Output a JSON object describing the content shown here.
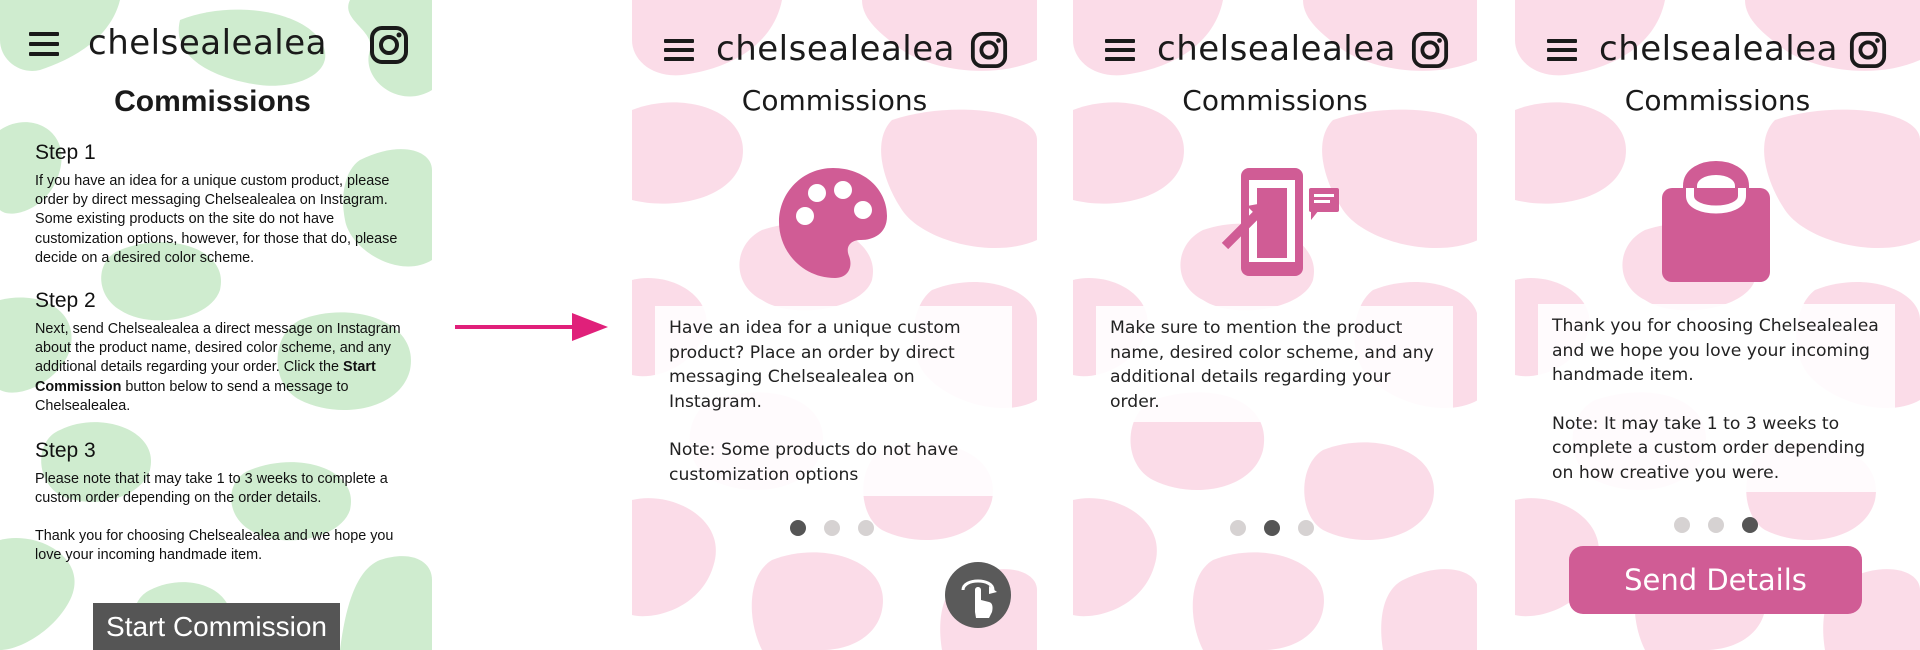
{
  "colors": {
    "accent": "#d05c95",
    "arrow": "#e0207a",
    "green_bg": "#cfeccf",
    "pink_bg": "#fbdce8",
    "button_gray": "#555555"
  },
  "before": {
    "brand": "chelsealealea",
    "title": "Commissions",
    "steps": [
      {
        "heading": "Step 1",
        "body": "If you have an idea for a unique custom product, please order by direct messaging Chelsealealea on Instagram. Some existing products on the site do not have customization options, however, for those that do, please decide on a desired color scheme."
      },
      {
        "heading": "Step 2",
        "body_before": "Next, send Chelsealealea a direct message on Instagram about the product name, desired color scheme, and any additional details regarding your order. Click the ",
        "body_bold": "Start Commission",
        "body_after": " button below to send a message to Chelsealealea."
      },
      {
        "heading": "Step 3",
        "body": "Please note that it may take 1 to 3 weeks to complete a custom order depending on the order details.",
        "body2": "Thank you for choosing Chelsealealea and we hope you love your incoming handmade item."
      }
    ],
    "start_button": "Start Commission"
  },
  "after": {
    "screens": [
      {
        "brand": "chelsealealea",
        "title": "Commissions",
        "icon": "palette-icon",
        "text": "Have an idea for a unique custom product? Place an order by direct messaging Chelsealealea on Instagram.",
        "note": "Note: Some products do not have customization options",
        "active_dot": 0
      },
      {
        "brand": "chelsealealea",
        "title": "Commissions",
        "icon": "phone-message-icon",
        "text": "Make sure to mention the product name, desired color scheme, and any additional details regarding your order.",
        "active_dot": 1
      },
      {
        "brand": "chelsealealea",
        "title": "Commissions",
        "icon": "shopping-bag-icon",
        "text": "Thank you for choosing Chelsealealea and we hope you love your incoming handmade item.",
        "note": "Note: It may take 1 to 3 weeks to complete a custom order depending on how creative you were.",
        "active_dot": 2,
        "button": "Send Details"
      }
    ],
    "swipe_icon": "swipe-gesture-icon"
  }
}
